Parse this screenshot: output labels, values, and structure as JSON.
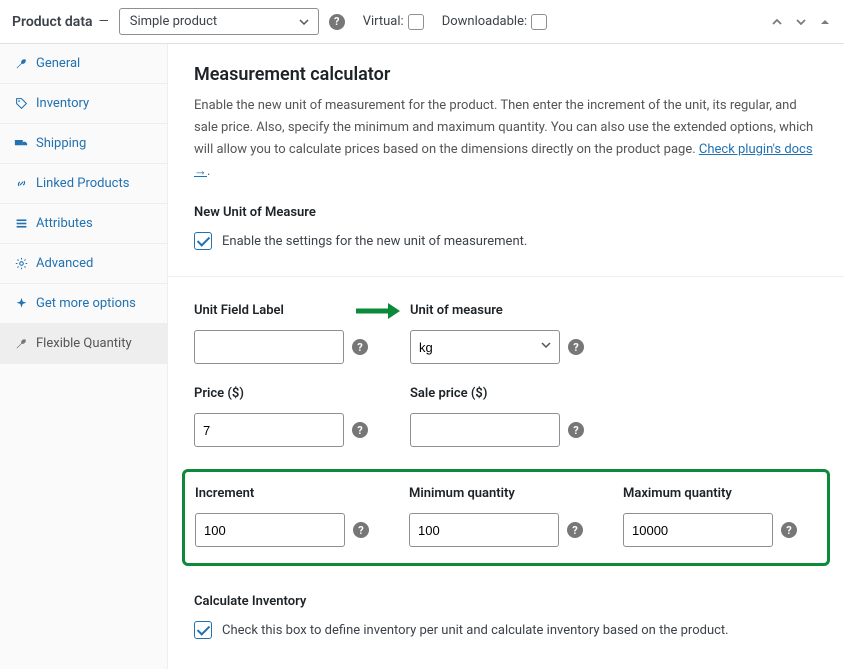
{
  "header": {
    "title": "Product data",
    "dash": "—",
    "product_type": "Simple product",
    "virtual_label": "Virtual:",
    "downloadable_label": "Downloadable:"
  },
  "sidebar": {
    "items": [
      {
        "label": "General"
      },
      {
        "label": "Inventory"
      },
      {
        "label": "Shipping"
      },
      {
        "label": "Linked Products"
      },
      {
        "label": "Attributes"
      },
      {
        "label": "Advanced"
      },
      {
        "label": "Get more options"
      },
      {
        "label": "Flexible Quantity"
      }
    ]
  },
  "panel": {
    "heading": "Measurement calculator",
    "description_1": "Enable the new unit of measurement for the product. Then enter the increment of the unit, its regular, and sale price. Also, specify the minimum and maximum quantity. You can also use the extended options, which will allow you to calculate prices based on the dimensions directly on the product page. ",
    "docs_link": "Check plugin's docs →",
    "new_unit_label": "New Unit of Measure",
    "enable_label": "Enable the settings for the new unit of measurement.",
    "unit_field_label": "Unit Field Label",
    "unit_of_measure_label": "Unit of measure",
    "unit_of_measure_value": "kg",
    "price_label": "Price ($)",
    "price_value": "7",
    "sale_price_label": "Sale price ($)",
    "sale_price_value": "",
    "increment_label": "Increment",
    "increment_value": "100",
    "min_qty_label": "Minimum quantity",
    "min_qty_value": "100",
    "max_qty_label": "Maximum quantity",
    "max_qty_value": "10000",
    "calc_inv_label": "Calculate Inventory",
    "calc_inv_check_label": "Check this box to define inventory per unit and calculate inventory based on the product."
  }
}
